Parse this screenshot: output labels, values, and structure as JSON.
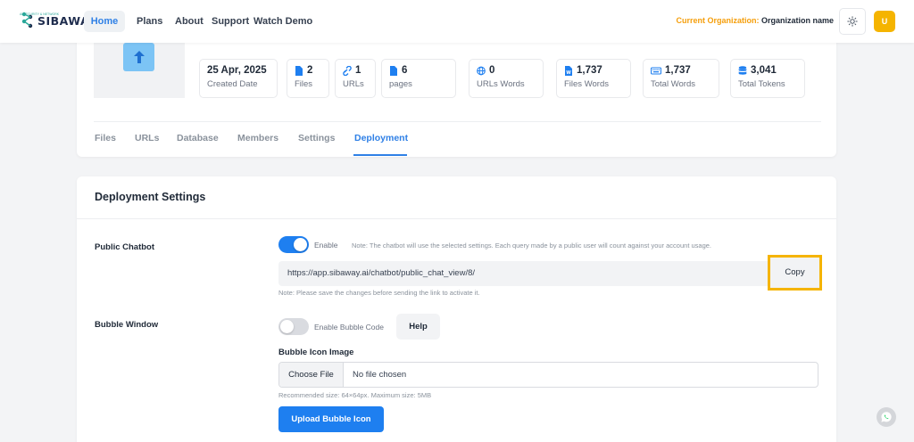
{
  "brand": {
    "name": "SIBAWAY",
    "tagline": "AI SECURITY & NETWORK"
  },
  "nav": {
    "home": "Home",
    "plans": "Plans",
    "about": "About",
    "support": "Support",
    "watch_demo": "Watch Demo"
  },
  "header": {
    "org_prefix": "Current Organization:",
    "org_name": "Organization name",
    "avatar_initial": "U"
  },
  "stats": [
    {
      "value": "25 Apr, 2025",
      "label": "Created Date",
      "icon": "none"
    },
    {
      "value": "2",
      "label": "Files",
      "icon": "file-icon"
    },
    {
      "value": "1",
      "label": "URLs",
      "icon": "link-icon"
    },
    {
      "value": "6",
      "label": "pages",
      "icon": "page-icon"
    },
    {
      "value": "0",
      "label": "URLs Words",
      "icon": "globe-icon"
    },
    {
      "value": "1,737",
      "label": "Files Words",
      "icon": "word-file-icon"
    },
    {
      "value": "1,737",
      "label": "Total Words",
      "icon": "keyboard-icon"
    },
    {
      "value": "3,041",
      "label": "Total Tokens",
      "icon": "database-icon"
    }
  ],
  "tabs": [
    "Files",
    "URLs",
    "Database",
    "Members",
    "Settings",
    "Deployment"
  ],
  "active_tab": "Deployment",
  "deployment": {
    "title": "Deployment Settings",
    "public_chatbot": {
      "label": "Public Chatbot",
      "toggle_label": "Enable",
      "enabled": true,
      "note": "Note: The chatbot will use the selected settings. Each query made by a public user will count against your account usage.",
      "url": "https://app.sibaway.ai/chatbot/public_chat_view/8/",
      "copy_label": "Copy",
      "save_note": "Note: Please save the changes before sending the link to activate it."
    },
    "bubble_window": {
      "label": "Bubble Window",
      "toggle_label": "Enable Bubble Code",
      "enabled": false,
      "help_label": "Help",
      "icon_image_label": "Bubble Icon Image",
      "choose_file": "Choose File",
      "no_file": "No file chosen",
      "recommended": "Recommended size: 64×64px. Maximum size: 5MB",
      "upload_label": "Upload Bubble Icon"
    }
  },
  "colors": {
    "accent": "#1e7ff0",
    "highlight": "#f5b400",
    "org_label": "#f59e0b"
  }
}
